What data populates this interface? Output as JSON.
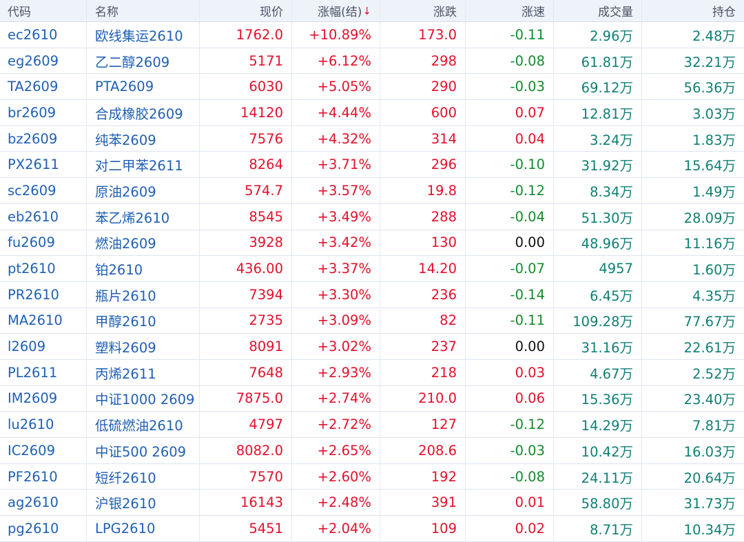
{
  "table": {
    "headers": {
      "code": "代码",
      "name": "名称",
      "price": "现价",
      "pct": "涨幅(结)",
      "change": "涨跌",
      "speed": "涨速",
      "volume": "成交量",
      "open_interest": "持仓"
    },
    "sort_indicator": "↓",
    "rows": [
      {
        "code": "ec2610",
        "name": "欧线集运2610",
        "price": "1762.0",
        "pct": "+10.89%",
        "change": "173.0",
        "speed": "-0.11",
        "volume": "2.96万",
        "open_interest": "2.48万"
      },
      {
        "code": "eg2609",
        "name": "乙二醇2609",
        "price": "5171",
        "pct": "+6.12%",
        "change": "298",
        "speed": "-0.08",
        "volume": "61.81万",
        "open_interest": "32.21万"
      },
      {
        "code": "TA2609",
        "name": "PTA2609",
        "price": "6030",
        "pct": "+5.05%",
        "change": "290",
        "speed": "-0.03",
        "volume": "69.12万",
        "open_interest": "56.36万"
      },
      {
        "code": "br2609",
        "name": "合成橡胶2609",
        "price": "14120",
        "pct": "+4.44%",
        "change": "600",
        "speed": "0.07",
        "volume": "12.81万",
        "open_interest": "3.03万"
      },
      {
        "code": "bz2609",
        "name": "纯苯2609",
        "price": "7576",
        "pct": "+4.32%",
        "change": "314",
        "speed": "0.04",
        "volume": "3.24万",
        "open_interest": "1.83万"
      },
      {
        "code": "PX2611",
        "name": "对二甲苯2611",
        "price": "8264",
        "pct": "+3.71%",
        "change": "296",
        "speed": "-0.10",
        "volume": "31.92万",
        "open_interest": "15.64万"
      },
      {
        "code": "sc2609",
        "name": "原油2609",
        "price": "574.7",
        "pct": "+3.57%",
        "change": "19.8",
        "speed": "-0.12",
        "volume": "8.34万",
        "open_interest": "1.49万"
      },
      {
        "code": "eb2610",
        "name": "苯乙烯2610",
        "price": "8545",
        "pct": "+3.49%",
        "change": "288",
        "speed": "-0.04",
        "volume": "51.30万",
        "open_interest": "28.09万"
      },
      {
        "code": "fu2609",
        "name": "燃油2609",
        "price": "3928",
        "pct": "+3.42%",
        "change": "130",
        "speed": "0.00",
        "volume": "48.96万",
        "open_interest": "11.16万"
      },
      {
        "code": "pt2610",
        "name": "铂2610",
        "price": "436.00",
        "pct": "+3.37%",
        "change": "14.20",
        "speed": "-0.07",
        "volume": "4957",
        "open_interest": "1.60万"
      },
      {
        "code": "PR2610",
        "name": "瓶片2610",
        "price": "7394",
        "pct": "+3.30%",
        "change": "236",
        "speed": "-0.14",
        "volume": "6.45万",
        "open_interest": "4.35万"
      },
      {
        "code": "MA2610",
        "name": "甲醇2610",
        "price": "2735",
        "pct": "+3.09%",
        "change": "82",
        "speed": "-0.11",
        "volume": "109.28万",
        "open_interest": "77.67万"
      },
      {
        "code": "l2609",
        "name": "塑料2609",
        "price": "8091",
        "pct": "+3.02%",
        "change": "237",
        "speed": "0.00",
        "volume": "31.16万",
        "open_interest": "22.61万"
      },
      {
        "code": "PL2611",
        "name": "丙烯2611",
        "price": "7648",
        "pct": "+2.93%",
        "change": "218",
        "speed": "0.03",
        "volume": "4.67万",
        "open_interest": "2.52万"
      },
      {
        "code": "IM2609",
        "name": "中证1000 2609",
        "price": "7875.0",
        "pct": "+2.74%",
        "change": "210.0",
        "speed": "0.06",
        "volume": "15.36万",
        "open_interest": "23.40万"
      },
      {
        "code": "lu2610",
        "name": "低硫燃油2610",
        "price": "4797",
        "pct": "+2.72%",
        "change": "127",
        "speed": "-0.12",
        "volume": "14.29万",
        "open_interest": "7.81万"
      },
      {
        "code": "IC2609",
        "name": "中证500 2609",
        "price": "8082.0",
        "pct": "+2.65%",
        "change": "208.6",
        "speed": "-0.03",
        "volume": "10.42万",
        "open_interest": "16.03万"
      },
      {
        "code": "PF2610",
        "name": "短纤2610",
        "price": "7570",
        "pct": "+2.60%",
        "change": "192",
        "speed": "-0.08",
        "volume": "24.11万",
        "open_interest": "20.64万"
      },
      {
        "code": "ag2610",
        "name": "沪银2610",
        "price": "16143",
        "pct": "+2.48%",
        "change": "391",
        "speed": "0.01",
        "volume": "58.80万",
        "open_interest": "31.73万"
      },
      {
        "code": "pg2610",
        "name": "LPG2610",
        "price": "5451",
        "pct": "+2.04%",
        "change": "109",
        "speed": "0.02",
        "volume": "8.71万",
        "open_interest": "10.34万"
      }
    ]
  },
  "colors": {
    "up": "#e3102a",
    "down": "#138a2a",
    "flat": "#111111",
    "volume": "#0f7f74",
    "link": "#1f5fb4",
    "header_bg": "#eef3fa"
  }
}
